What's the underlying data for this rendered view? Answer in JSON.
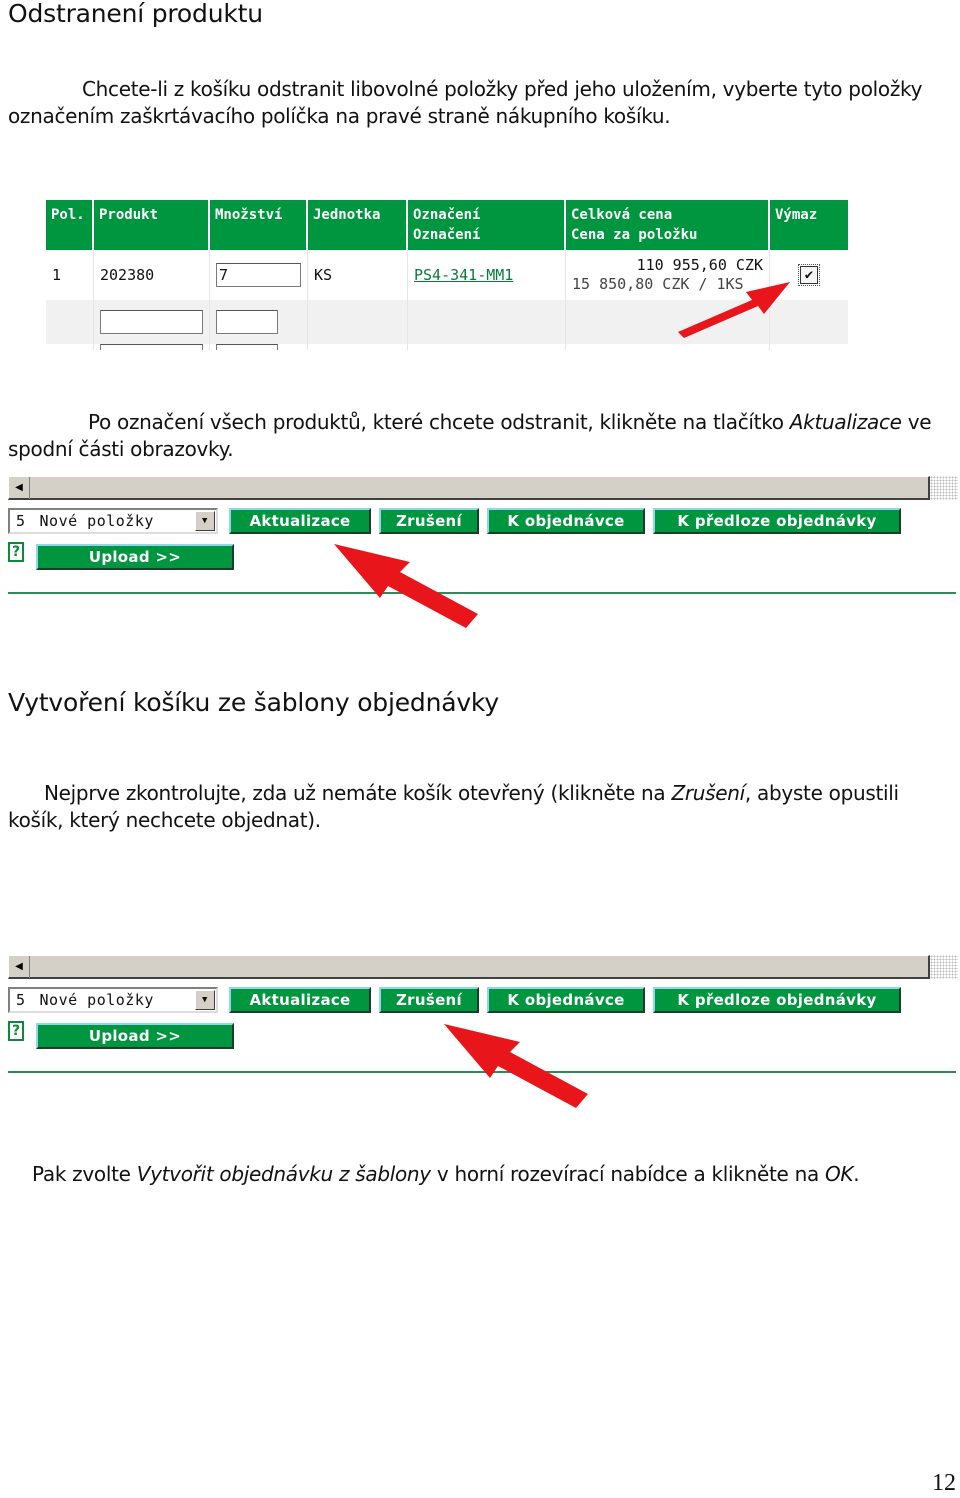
{
  "section1": {
    "title": "Odstranení produktu",
    "intro": "Chcete-li z košíku odstranit libovolné položky před jeho uložením, vyberte tyto položky označením zaškrtávacího políčka na pravé straně nákupního košíku."
  },
  "cart": {
    "headers": {
      "pol": "Pol.",
      "produkt": "Produkt",
      "mnozstvi": "Množství",
      "jednotka": "Jednotka",
      "oznaceni_1": "Označení",
      "oznaceni_2": "Označení",
      "cena_1": "Celková cena",
      "cena_2": "Cena za položku",
      "vymaz": "Výmaz"
    },
    "rows": [
      {
        "pol": "1",
        "produkt": "202380",
        "mnozstvi": "7",
        "jednotka": "KS",
        "oznaceni": "PS4-341-MM1",
        "celkova_cena": "110 955,60 CZK",
        "cena_za_polozku": "15 850,80 CZK / 1KS",
        "vymaz_checked": true,
        "checkbox_glyph": "✔"
      }
    ],
    "empty_row": {
      "produkt": "",
      "mnozstvi": ""
    },
    "annotation_color": "#e8161b"
  },
  "section1b": {
    "text_lead": "Po označení všech produktů, které chcete odstranit, klikněte na tlačítko",
    "text_italic": "Aktualizace",
    "text_tail": "ve spodní části obrazovky."
  },
  "toolbar": {
    "scroll_left_glyph": "◀",
    "select_number": "5",
    "select_label": "Nové položky",
    "select_dropdown_glyph": "▼",
    "buttons": {
      "aktualizace": "Aktualizace",
      "zruseni": "Zrušení",
      "k_objednavce": "K objednávce",
      "k_predloze": "K předloze objednávky",
      "upload": "Upload >>"
    },
    "help_glyph": "?",
    "accent": "#00963f"
  },
  "section2": {
    "title": "Vytvoření košíku ze šablony objednávky",
    "text1_lead": "Nejprve zkontrolujte, zda už nemáte košík otevřený (klikněte na",
    "text1_italic": "Zrušení",
    "text1_tail": ", abyste opustili košík, který nechcete objednat).",
    "text2_lead": "Pak zvolte",
    "text2_italic": "Vytvořit objednávku z šablony",
    "text2_mid": "v horní rozevírací nabídce a klikněte na",
    "text2_italic2": "OK",
    "text2_tail": "."
  },
  "page_number": "12"
}
